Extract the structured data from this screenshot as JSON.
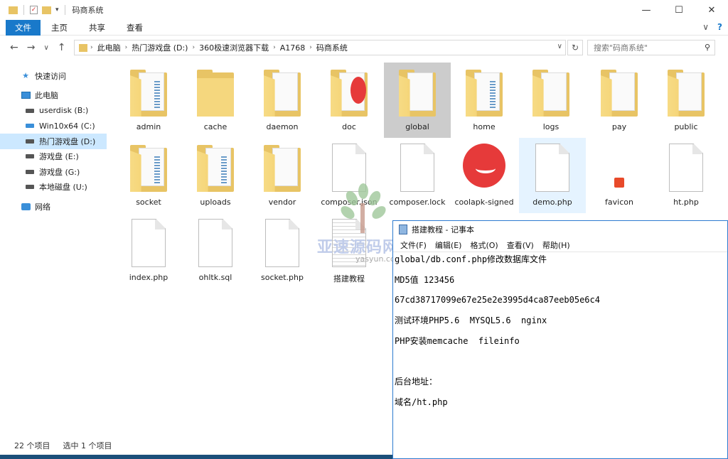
{
  "explorer": {
    "title": "码商系统",
    "window_controls": {
      "minimize": "—",
      "maximize": "☐",
      "close": "✕"
    },
    "ribbon": {
      "tabs": [
        "文件",
        "主页",
        "共享",
        "查看"
      ],
      "collapse": "∨",
      "help": "?"
    },
    "nav": {
      "back": "←",
      "forward": "→",
      "recent": "∨",
      "up": "↑"
    },
    "address": {
      "crumbs": [
        "此电脑",
        "热门游戏盘 (D:)",
        "360极速浏览器下载",
        "A1768",
        "码商系统"
      ],
      "dropdown": "∨",
      "refresh": "↻"
    },
    "search": {
      "placeholder": "搜索\"码商系统\"",
      "icon": "⚲"
    },
    "sidebar": {
      "items": [
        {
          "label": "快速访问",
          "icon": "star-icon"
        },
        {
          "label": "此电脑",
          "icon": "pc-icon"
        },
        {
          "label": "userdisk (B:)",
          "icon": "drive-icon"
        },
        {
          "label": "Win10x64 (C:)",
          "icon": "system-drive-icon"
        },
        {
          "label": "热门游戏盘 (D:)",
          "icon": "drive-icon",
          "selected": true
        },
        {
          "label": "游戏盘 (E:)",
          "icon": "drive-icon"
        },
        {
          "label": "游戏盘 (G:)",
          "icon": "drive-icon"
        },
        {
          "label": "本地磁盘 (U:)",
          "icon": "drive-icon"
        },
        {
          "label": "网络",
          "icon": "network-icon"
        }
      ]
    },
    "files": [
      {
        "name": "admin",
        "type": "folder"
      },
      {
        "name": "cache",
        "type": "folder"
      },
      {
        "name": "daemon",
        "type": "folder"
      },
      {
        "name": "doc",
        "type": "folder"
      },
      {
        "name": "global",
        "type": "folder",
        "selected": true
      },
      {
        "name": "home",
        "type": "folder"
      },
      {
        "name": "logs",
        "type": "folder"
      },
      {
        "name": "pay",
        "type": "folder"
      },
      {
        "name": "public",
        "type": "folder"
      },
      {
        "name": "socket",
        "type": "folder"
      },
      {
        "name": "uploads",
        "type": "folder"
      },
      {
        "name": "vendor",
        "type": "folder"
      },
      {
        "name": "composer.json",
        "type": "file"
      },
      {
        "name": "composer.lock",
        "type": "file"
      },
      {
        "name": "coolapk-signed",
        "type": "app"
      },
      {
        "name": "demo.php",
        "type": "file",
        "hover": true
      },
      {
        "name": "favicon",
        "type": "image"
      },
      {
        "name": "ht.php",
        "type": "file"
      },
      {
        "name": "index.php",
        "type": "file"
      },
      {
        "name": "ohltk.sql",
        "type": "file"
      },
      {
        "name": "socket.php",
        "type": "file"
      },
      {
        "name": "搭建教程",
        "type": "textfile"
      }
    ],
    "status": {
      "count": "22 个项目",
      "selected": "选中 1 个项目"
    }
  },
  "notepad": {
    "title": "搭建教程 - 记事本",
    "menu": [
      "文件(F)",
      "编辑(E)",
      "格式(O)",
      "查看(V)",
      "帮助(H)"
    ],
    "lines": [
      "global/db.conf.php修改数据库文件",
      "MD5值 123456",
      "67cd38717099e67e25e2e3995d4ca87eeb05e6c4",
      "测试环境PHP5.6  MYSQL5.6  nginx",
      "PHP安装memcache  fileinfo",
      "",
      "后台地址：",
      "域名/ht.php"
    ]
  },
  "watermark": {
    "text": "亚速源码网",
    "sub": "yasyun.com"
  },
  "colors": {
    "accent": "#1979ca",
    "selected_nav": "#cce8ff",
    "folder": "#e8c465",
    "notepad_border": "#2d7bd0"
  }
}
